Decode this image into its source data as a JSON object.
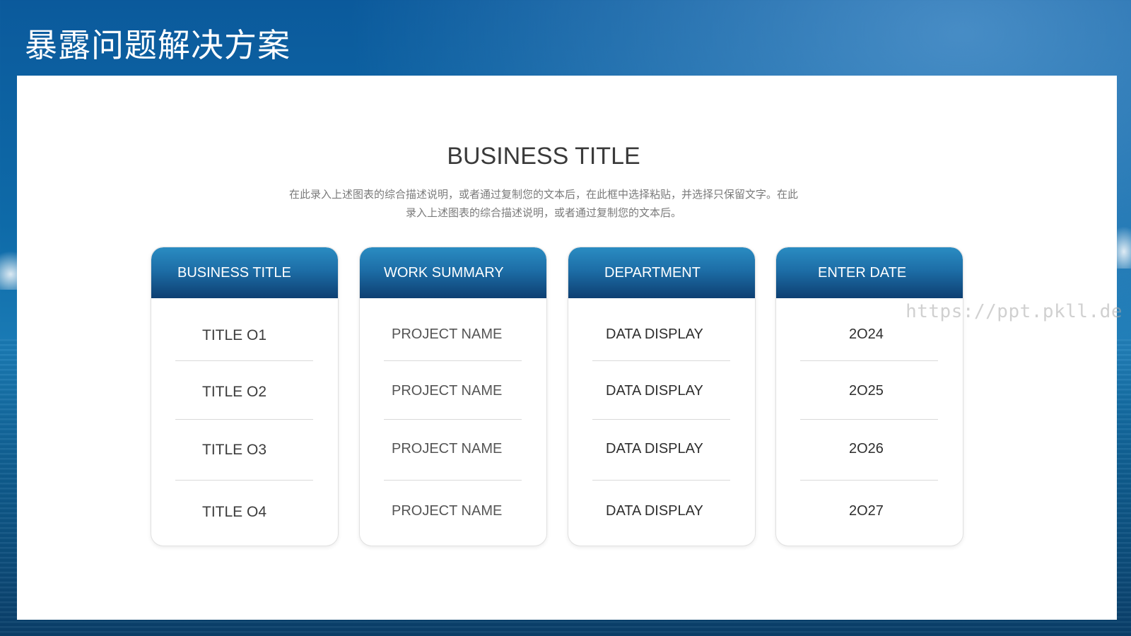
{
  "page": {
    "title": "暴露问题解决方案",
    "watermark": "https://ppt.pkll.de"
  },
  "content": {
    "main_title": "BUSINESS TITLE",
    "description_line1": "在此录入上述图表的综合描述说明，或者通过复制您的文本后，在此框中选择粘贴，并选择只保留文字。在此",
    "description_line2": "录入上述图表的综合描述说明，或者通过复制您的文本后。"
  },
  "columns": [
    {
      "header": "BUSINESS TITLE",
      "rows": [
        "TITLE O1",
        "TITLE O2",
        "TITLE O3",
        "TITLE O4"
      ]
    },
    {
      "header": "WORK SUMMARY",
      "rows": [
        "PROJECT NAME",
        "PROJECT NAME",
        "PROJECT NAME",
        "PROJECT NAME"
      ]
    },
    {
      "header": "DEPARTMENT",
      "rows": [
        "DATA DISPLAY",
        "DATA DISPLAY",
        "DATA DISPLAY",
        "DATA DISPLAY"
      ]
    },
    {
      "header": "ENTER DATE",
      "rows": [
        "2O24",
        "2O25",
        "2O26",
        "2O27"
      ]
    }
  ],
  "colors": {
    "header_gradient_top": "#2a8cc2",
    "header_gradient_bottom": "#0d3f72",
    "background_sea": "#0e6aa8"
  }
}
